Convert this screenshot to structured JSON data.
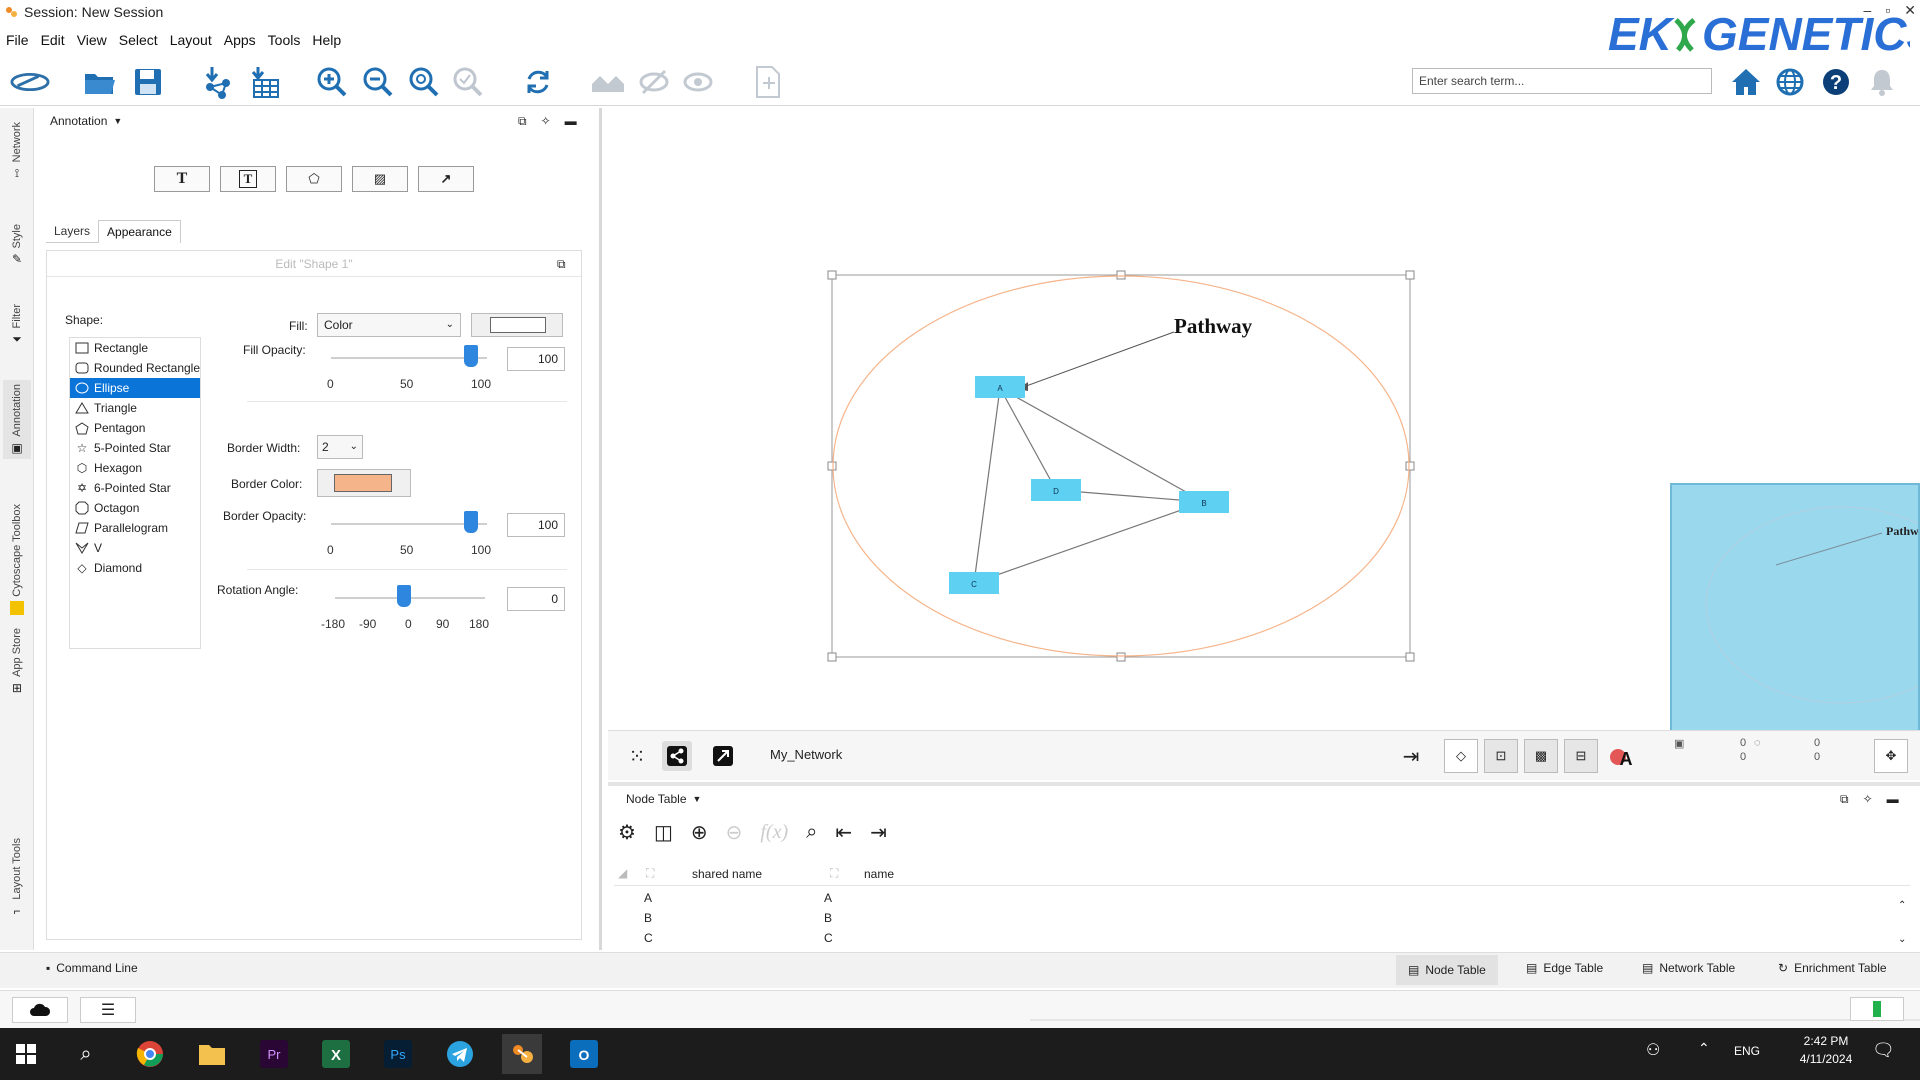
{
  "window": {
    "title": "Session: New Session"
  },
  "brand": {
    "logo_text": "EKXGENETICS",
    "color": "#2a6fd6",
    "accent": "#2ea84a"
  },
  "menu": [
    "File",
    "Edit",
    "View",
    "Select",
    "Layout",
    "Apps",
    "Tools",
    "Help"
  ],
  "search": {
    "placeholder": "Enter search term..."
  },
  "vertical_tabs": [
    "Network",
    "Style",
    "Filter",
    "Annotation",
    "Cytoscape Toolbox",
    "App Store",
    "Layout Tools"
  ],
  "annotation_panel": {
    "header": "Annotation",
    "tabs": [
      "Layers",
      "Appearance"
    ],
    "edit_title": "Edit \"Shape 1\"",
    "shape_label": "Shape:",
    "shapes": [
      "Rectangle",
      "Rounded Rectangle",
      "Ellipse",
      "Triangle",
      "Pentagon",
      "5-Pointed Star",
      "Hexagon",
      "6-Pointed Star",
      "Octagon",
      "Parallelogram",
      "V",
      "Diamond"
    ],
    "selected_shape": "Ellipse",
    "fill_label": "Fill:",
    "fill_value": "Color",
    "fill_color": "#ffffff",
    "fill_opacity_label": "Fill Opacity:",
    "fill_opacity": "100",
    "opacity_ticks": [
      "0",
      "50",
      "100"
    ],
    "border_width_label": "Border Width:",
    "border_width": "2",
    "border_color_label": "Border Color:",
    "border_color": "#f6b48a",
    "border_opacity_label": "Border Opacity:",
    "border_opacity": "100",
    "rotation_label": "Rotation Angle:",
    "rotation": "0",
    "rotation_ticks": [
      "-180",
      "-90",
      "0",
      "90",
      "180"
    ]
  },
  "network": {
    "annotation_text": "Pathway",
    "nodes": [
      {
        "id": "A",
        "label": "A"
      },
      {
        "id": "B",
        "label": "B"
      },
      {
        "id": "C",
        "label": "C"
      },
      {
        "id": "D",
        "label": "D"
      }
    ],
    "node_color": "#5ed0f2",
    "view_name": "My_Network",
    "overview_label": "Pathw",
    "counts": [
      "0",
      "0",
      "0",
      "0"
    ]
  },
  "node_table": {
    "header": "Node Table",
    "columns": [
      "shared name",
      "name"
    ],
    "rows": [
      [
        "A",
        "A"
      ],
      [
        "B",
        "B"
      ],
      [
        "C",
        "C"
      ]
    ]
  },
  "bottom_tabs": [
    "Command Line",
    "Node Table",
    "Edge Table",
    "Network Table",
    "Enrichment Table"
  ],
  "taskbar": {
    "time": "2:42 PM",
    "date": "4/11/2024",
    "lang": "ENG"
  }
}
